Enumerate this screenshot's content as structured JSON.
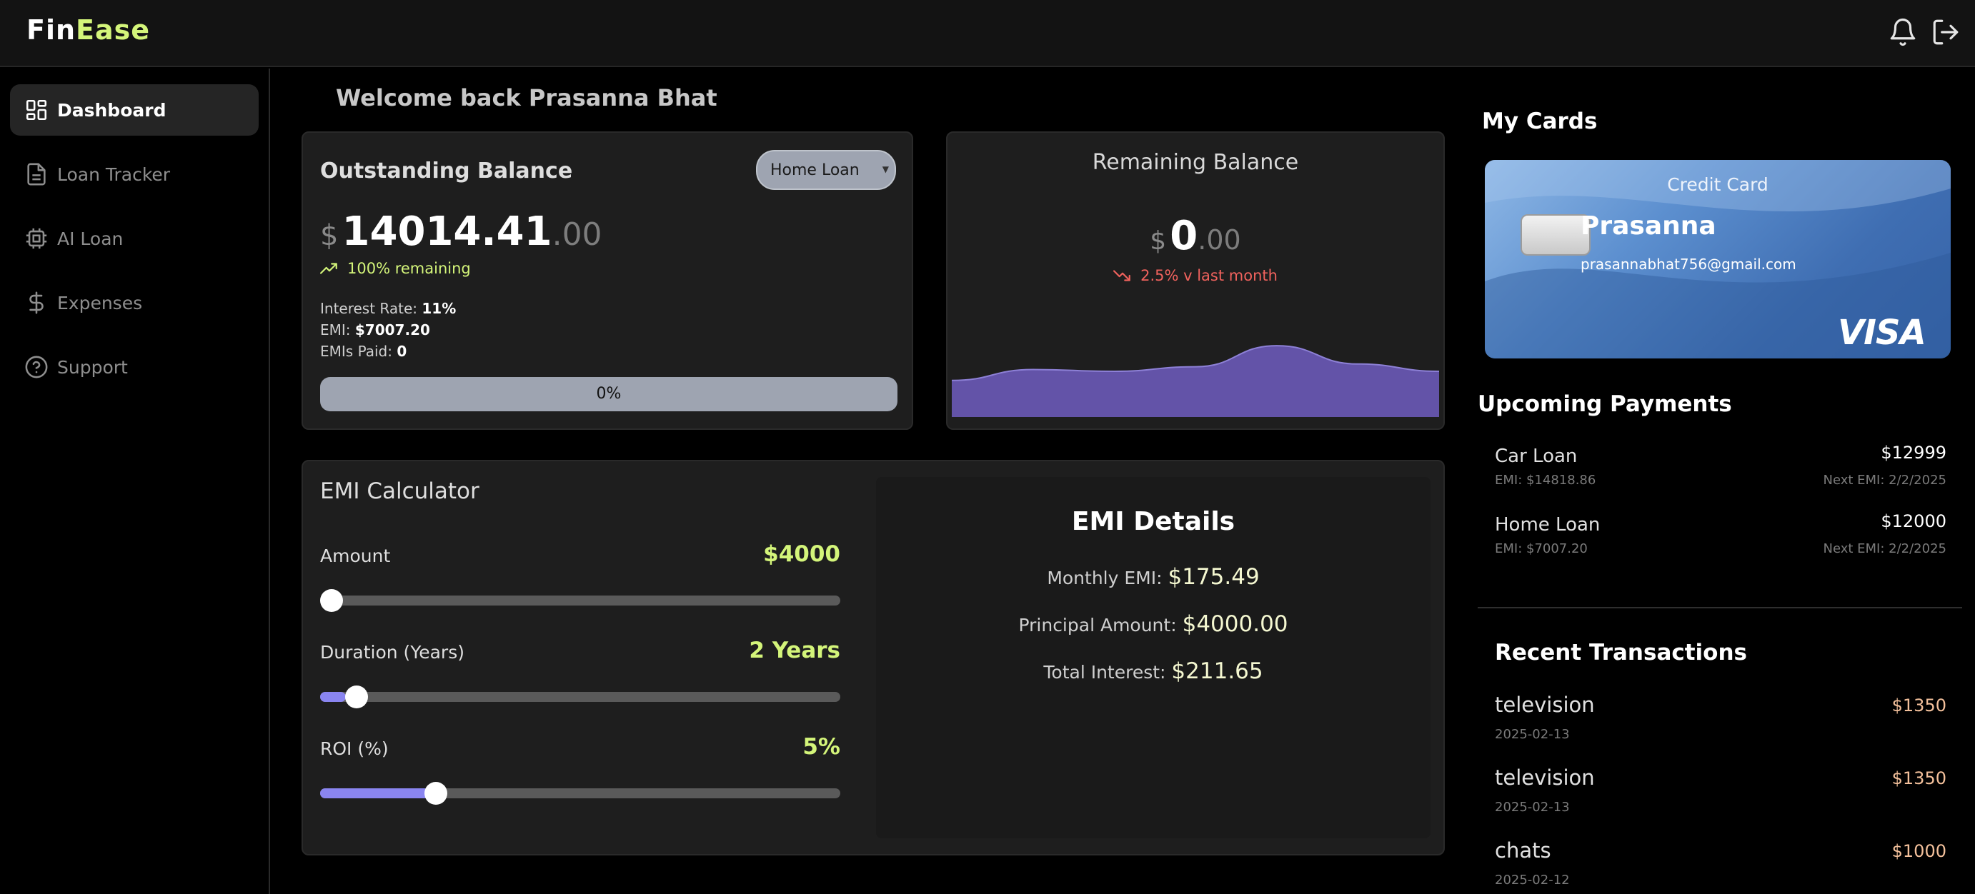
{
  "header": {
    "logo_part1": "Fin",
    "logo_part2": "Ease",
    "notifications_icon": "bell-icon",
    "logout_icon": "logout-icon"
  },
  "sidebar": {
    "items": [
      {
        "label": "Dashboard",
        "icon": "dashboard-icon",
        "active": true
      },
      {
        "label": "Loan Tracker",
        "icon": "document-icon",
        "active": false
      },
      {
        "label": "AI Loan",
        "icon": "chip-icon",
        "active": false
      },
      {
        "label": "Expenses",
        "icon": "dollar-icon",
        "active": false
      },
      {
        "label": "Support",
        "icon": "help-icon",
        "active": false
      }
    ]
  },
  "main": {
    "welcome": "Welcome back Prasanna Bhat",
    "outstanding": {
      "title": "Outstanding Balance",
      "selected_loan": "Home Loan",
      "currency": "$",
      "amount_int": "14014.41",
      "amount_dec": ".00",
      "trend_text": "100% remaining",
      "interest_label": "Interest Rate:",
      "interest_value": "11%",
      "emi_label": "EMI:",
      "emi_value": "$7007.20",
      "emis_paid_label": "EMIs Paid:",
      "emis_paid_value": "0",
      "progress_text": "0%",
      "progress_fraction": 0
    },
    "remaining": {
      "title": "Remaining Balance",
      "currency": "$",
      "amount_int": "0",
      "amount_dec": ".00",
      "trend_text": "2.5% v last month",
      "chart_data": {
        "type": "area",
        "values": [
          40,
          52,
          50,
          55,
          78,
          58,
          50
        ],
        "ylim": [
          0,
          100
        ],
        "fill": "#6353a8",
        "stroke": "#8d80d6"
      }
    },
    "calculator": {
      "title": "EMI Calculator",
      "amount_label": "Amount",
      "amount_value": "$4000",
      "amount_fraction": 0,
      "duration_label": "Duration (Years)",
      "duration_value": "2 Years",
      "duration_fraction": 0.05,
      "roi_label": "ROI (%)",
      "roi_value": "5%",
      "roi_fraction": 0.21
    },
    "emi_details": {
      "title": "EMI Details",
      "monthly_label": "Monthly EMI:",
      "monthly_value": "$175.49",
      "principal_label": "Principal Amount:",
      "principal_value": "$4000.00",
      "interest_label": "Total Interest:",
      "interest_value": "$211.65"
    }
  },
  "right": {
    "cards_title": "My Cards",
    "card": {
      "type": "Credit Card",
      "name": "Prasanna",
      "email": "prasannabhat756@gmail.com",
      "network": "VISA"
    },
    "payments_title": "Upcoming Payments",
    "payments": [
      {
        "name": "Car Loan",
        "amount": "$12999",
        "emi": "EMI: $14818.86",
        "next": "Next EMI: 2/2/2025"
      },
      {
        "name": "Home Loan",
        "amount": "$12000",
        "emi": "EMI: $7007.20",
        "next": "Next EMI: 2/2/2025"
      }
    ],
    "transactions_title": "Recent Transactions",
    "transactions": [
      {
        "name": "television",
        "amount": "$1350",
        "date": "2025-02-13"
      },
      {
        "name": "television",
        "amount": "$1350",
        "date": "2025-02-13"
      },
      {
        "name": "chats",
        "amount": "$1000",
        "date": "2025-02-12"
      }
    ]
  },
  "colors": {
    "accent": "#d4f57a",
    "slider": "#8a85f0",
    "negative": "#f0625d"
  }
}
